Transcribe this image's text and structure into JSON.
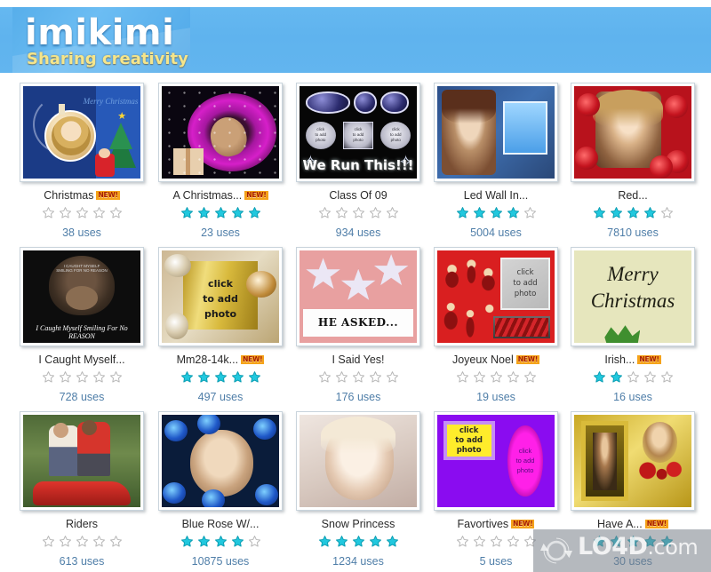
{
  "header": {
    "logo_word": "imikimi",
    "tagline": "Sharing creativity",
    "bg_color": "#62b5ef"
  },
  "watermark": {
    "text": "LO4D",
    "suffix": ".com",
    "icon": "refresh-circle-icon"
  },
  "labels": {
    "new_badge": "NEW!",
    "uses_suffix": "uses",
    "click_to_add": "click to add photo"
  },
  "colors": {
    "star_filled": "#21c8de",
    "star_empty": "#b8b8b8",
    "uses_text": "#4f7ea8",
    "badge_bg": "#f5a31a",
    "badge_text": "#a61c00"
  },
  "grid": {
    "columns": 5,
    "rows": 3,
    "items": [
      {
        "title": "Christmas",
        "is_new": true,
        "rating": 0,
        "max_rating": 5,
        "uses": "38 uses",
        "art": "a-xmas"
      },
      {
        "title": "A Christmas...",
        "is_new": true,
        "rating": 5,
        "max_rating": 5,
        "uses": "23 uses",
        "art": "a-purple"
      },
      {
        "title": "Class Of 09",
        "is_new": false,
        "rating": 0,
        "max_rating": 5,
        "uses": "934 uses",
        "art": "a-class"
      },
      {
        "title": "Led Wall In...",
        "is_new": false,
        "rating": 4,
        "max_rating": 5,
        "uses": "5004 uses",
        "art": "a-led"
      },
      {
        "title": "Red...",
        "is_new": false,
        "rating": 4,
        "max_rating": 5,
        "uses": "7810 uses",
        "art": "a-red"
      },
      {
        "title": "I Caught Myself...",
        "is_new": false,
        "rating": 0,
        "max_rating": 5,
        "uses": "728 uses",
        "art": "a-monkey"
      },
      {
        "title": "Mm28-14k...",
        "is_new": true,
        "rating": 5,
        "max_rating": 5,
        "uses": "497 uses",
        "art": "a-gold"
      },
      {
        "title": "I Said Yes!",
        "is_new": false,
        "rating": 0,
        "max_rating": 5,
        "uses": "176 uses",
        "art": "a-pink"
      },
      {
        "title": "Joyeux Noel",
        "is_new": true,
        "rating": 0,
        "max_rating": 5,
        "uses": "19 uses",
        "art": "a-noel"
      },
      {
        "title": "Irish...",
        "is_new": true,
        "rating": 2,
        "max_rating": 5,
        "uses": "16 uses",
        "art": "a-merry"
      },
      {
        "title": "Riders",
        "is_new": false,
        "rating": 0,
        "max_rating": 5,
        "uses": "613 uses",
        "art": "a-riders"
      },
      {
        "title": "Blue Rose W/...",
        "is_new": false,
        "rating": 4,
        "max_rating": 5,
        "uses": "10875 uses",
        "art": "a-bluerose"
      },
      {
        "title": "Snow Princess",
        "is_new": false,
        "rating": 5,
        "max_rating": 5,
        "uses": "1234 uses",
        "art": "a-snow"
      },
      {
        "title": "Favortives",
        "is_new": true,
        "rating": 0,
        "max_rating": 5,
        "uses": "5 uses",
        "art": "a-fav"
      },
      {
        "title": "Have A...",
        "is_new": true,
        "rating": 5,
        "max_rating": 5,
        "uses": "30 uses",
        "art": "a-glam"
      }
    ]
  }
}
